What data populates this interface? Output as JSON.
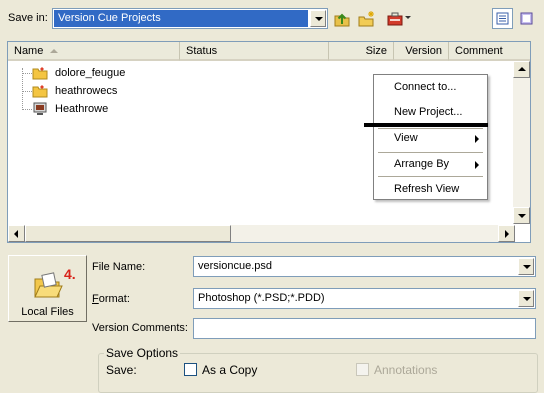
{
  "toolbar": {
    "save_in_label": "Save in:",
    "location_value": "Version Cue Projects",
    "icons": [
      "up-folder-icon",
      "new-folder-icon",
      "tools-menu-icon",
      "details-view-icon",
      "thumbnail-view-icon"
    ]
  },
  "file_list": {
    "columns": [
      "Name",
      "Status",
      "Size",
      "Version",
      "Comment"
    ],
    "items": [
      {
        "name": "dolore_feugue",
        "icon": "project-folder-icon"
      },
      {
        "name": "heathrowecs",
        "icon": "project-folder-icon"
      },
      {
        "name": "Heathrowe",
        "icon": "server-icon"
      }
    ]
  },
  "context_menu": {
    "items": [
      "Connect to...",
      "New Project...",
      "View",
      "Arrange By",
      "Refresh View"
    ],
    "highlighted": "New Project..."
  },
  "local_files": {
    "label": "Local Files",
    "step": "4."
  },
  "form": {
    "file_name_label": "File Name:",
    "file_name_value": "versioncue.psd",
    "format_label_first": "F",
    "format_label_rest": "ormat:",
    "format_value": "Photoshop (*.PSD;*.PDD)",
    "version_comments_label": "Version Comments:",
    "version_comments_value": ""
  },
  "save_options": {
    "title": "Save Options",
    "save_label": "Save:",
    "as_copy_label": "As a Copy",
    "annotations_label": "Annotations",
    "as_copy_checked": false,
    "annotations_checked": false,
    "annotations_enabled": false
  },
  "colors": {
    "selection": "#316ac5",
    "dialog_bg": "#ece9d8",
    "step_number": "#d9241b"
  }
}
